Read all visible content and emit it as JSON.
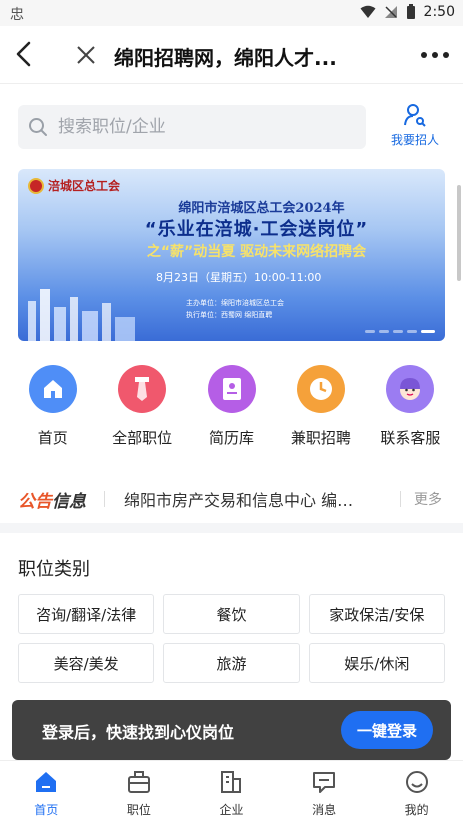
{
  "status_bar": {
    "left_icon": "忠",
    "time": "2:50"
  },
  "header": {
    "title": "绵阳招聘网，绵阳人才..."
  },
  "search": {
    "placeholder": "搜索职位/企业",
    "recruit_label": "我要招人"
  },
  "banner": {
    "logo_text": "涪城区总工会",
    "line1": "绵阳市涪城区总工会2024年",
    "line2": "“乐业在涪城·工会送岗位”",
    "line3": "之“薪”动当夏  驱动未来网络招聘会",
    "line4": "8月23日（星期五）10:00-11:00",
    "line5": "主办单位：绵阳市涪城区总工会",
    "line6": "执行单位：西蜀网    绵阳直聘"
  },
  "quick_nav": [
    {
      "label": "首页",
      "icon": "home-icon",
      "color": "#4f8ef7"
    },
    {
      "label": "全部职位",
      "icon": "tie-icon",
      "color": "#f0586d"
    },
    {
      "label": "简历库",
      "icon": "resume-icon",
      "color": "#b55ee6"
    },
    {
      "label": "兼职招聘",
      "icon": "clock-icon",
      "color": "#f5a13a"
    },
    {
      "label": "联系客服",
      "icon": "service-icon",
      "color": "#9b7cf2"
    }
  ],
  "notice": {
    "brand_a": "公告",
    "brand_b": "信息",
    "text": "绵阳市房产交易和信息中心 编外用工招聘公告",
    "more": "更多"
  },
  "categories": {
    "title": "职位类别",
    "items": [
      "咨询/翻译/法律",
      "餐饮",
      "家政保洁/安保",
      "美容/美发",
      "旅游",
      "娱乐/休闲"
    ]
  },
  "login_toast": {
    "message": "登录后，快速找到心仪岗位",
    "button": "一键登录"
  },
  "tabs": [
    {
      "label": "首页",
      "icon": "home-tab-icon"
    },
    {
      "label": "职位",
      "icon": "briefcase-icon"
    },
    {
      "label": "企业",
      "icon": "building-icon"
    },
    {
      "label": "消息",
      "icon": "message-icon"
    },
    {
      "label": "我的",
      "icon": "profile-icon"
    }
  ],
  "colors": {
    "accent": "#1f6ff2",
    "notice_orange": "#e8562a"
  }
}
